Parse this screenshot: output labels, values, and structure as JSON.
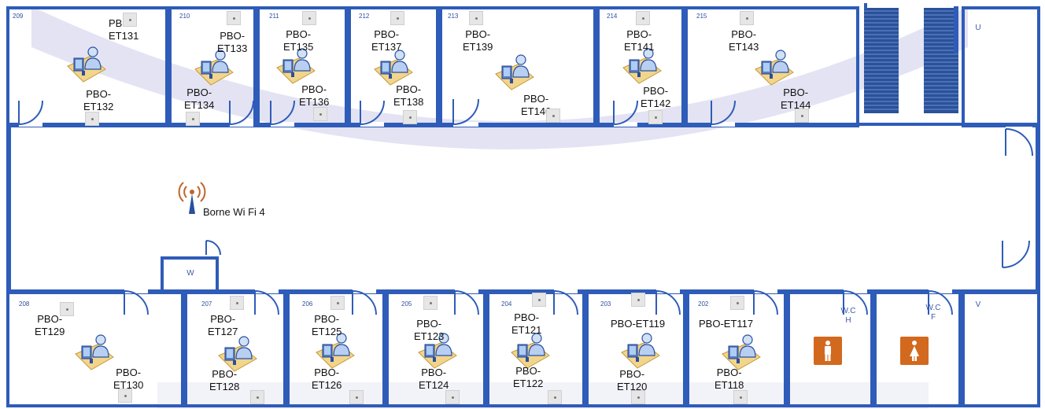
{
  "colors": {
    "wall": "#2e5cb8",
    "stairs": "#2a5298",
    "watermark": "#d9d9ef",
    "wc_sign": "#d2691e",
    "wifi_wave": "#c0642a"
  },
  "top_rooms": [
    {
      "number": "209",
      "upper_label": [
        "PBO-",
        "ET131"
      ],
      "lower_label": [
        "PBO-",
        "ET132"
      ]
    },
    {
      "number": "210",
      "upper_label": [
        "PBO-",
        "ET133"
      ],
      "lower_label": [
        "PBO-",
        "ET134"
      ]
    },
    {
      "number": "211",
      "upper_label": [
        "PBO-",
        "ET135"
      ],
      "lower_label": [
        "PBO-",
        "ET136"
      ]
    },
    {
      "number": "212",
      "upper_label": [
        "PBO-",
        "ET137"
      ],
      "lower_label": [
        "PBO-",
        "ET138"
      ]
    },
    {
      "number": "213",
      "upper_label": [
        "PBO-",
        "ET139"
      ],
      "lower_label": [
        "PBO-",
        "ET140"
      ]
    },
    {
      "number": "214",
      "upper_label": [
        "PBO-",
        "ET141"
      ],
      "lower_label": [
        "PBO-",
        "ET142"
      ]
    },
    {
      "number": "215",
      "upper_label": [
        "PBO-",
        "ET143"
      ],
      "lower_label": [
        "PBO-",
        "ET144"
      ]
    }
  ],
  "bottom_rooms": [
    {
      "number": "208",
      "upper_label": [
        "PBO-",
        "ET129"
      ],
      "lower_label": [
        "PBO-",
        "ET130"
      ]
    },
    {
      "number": "207",
      "upper_label": [
        "PBO-",
        "ET127"
      ],
      "lower_label": [
        "PBO-",
        "ET128"
      ]
    },
    {
      "number": "206",
      "upper_label": [
        "PBO-",
        "ET125"
      ],
      "lower_label": [
        "PBO-",
        "ET126"
      ]
    },
    {
      "number": "205",
      "upper_label": [
        "PBO-",
        "ET123"
      ],
      "lower_label": [
        "PBO-",
        "ET124"
      ]
    },
    {
      "number": "204",
      "upper_label": [
        "PBO-",
        "ET121"
      ],
      "lower_label": [
        "PBO-",
        "ET122"
      ]
    },
    {
      "number": "203",
      "upper_label": [
        "PBO-ET119"
      ],
      "lower_label": [
        "PBO-",
        "ET120"
      ]
    },
    {
      "number": "202",
      "upper_label": [
        "PBO-ET117"
      ],
      "lower_label": [
        "PBO-",
        "ET118"
      ]
    }
  ],
  "wifi": {
    "label": "Borne Wi Fi 4",
    "icon": "wifi-antenna-icon"
  },
  "service_rooms": {
    "u": "U",
    "w": "W",
    "v": "V",
    "wc_men": [
      "W.C",
      "H"
    ],
    "wc_women": [
      "W.C",
      "F"
    ]
  },
  "icons": {
    "workstation": "desktop-user-icon",
    "network_point": "network-outlet-icon",
    "men": "men-restroom-icon",
    "women": "women-restroom-icon",
    "stairs": "staircase-icon"
  }
}
